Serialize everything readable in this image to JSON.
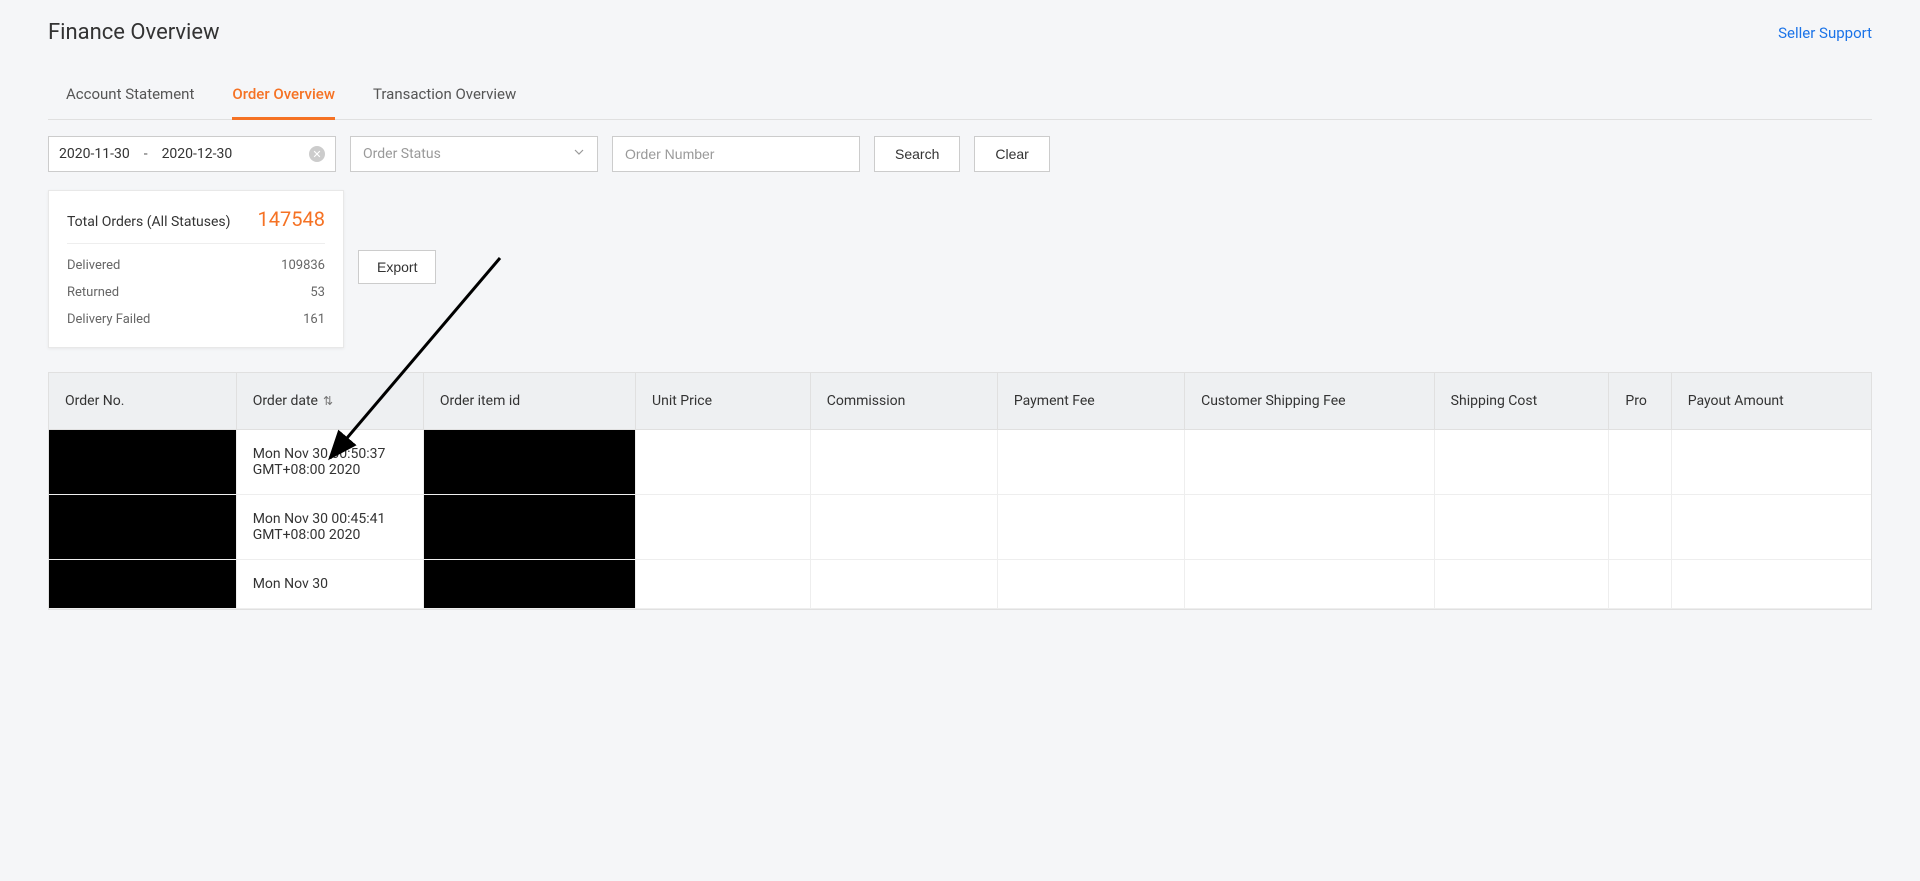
{
  "header": {
    "title": "Finance Overview",
    "support_link": "Seller Support"
  },
  "tabs": {
    "account_statement": "Account Statement",
    "order_overview": "Order Overview",
    "transaction_overview": "Transaction Overview",
    "active_index": 1
  },
  "filters": {
    "date_from": "2020-11-30",
    "date_to": "2020-12-30",
    "order_status_placeholder": "Order Status",
    "order_number_placeholder": "Order Number",
    "search_label": "Search",
    "clear_label": "Clear"
  },
  "summary": {
    "title": "Total Orders (All Statuses)",
    "total": "147548",
    "rows": [
      {
        "label": "Delivered",
        "value": "109836"
      },
      {
        "label": "Returned",
        "value": "53"
      },
      {
        "label": "Delivery Failed",
        "value": "161"
      }
    ],
    "export_label": "Export"
  },
  "table": {
    "columns": {
      "order_no": "Order No.",
      "order_date": "Order date",
      "order_item_id": "Order item id",
      "unit_price": "Unit Price",
      "commission": "Commission",
      "payment_fee": "Payment Fee",
      "customer_shipping_fee": "Customer Shipping Fee",
      "shipping_cost": "Shipping Cost",
      "promo": "Pro",
      "payout_amount": "Payout Amount"
    },
    "rows": [
      {
        "order_date": "Mon Nov 30 00:50:37 GMT+08:00 2020"
      },
      {
        "order_date": "Mon Nov 30 00:45:41 GMT+08:00 2020"
      },
      {
        "order_date": "Mon Nov 30"
      }
    ]
  }
}
